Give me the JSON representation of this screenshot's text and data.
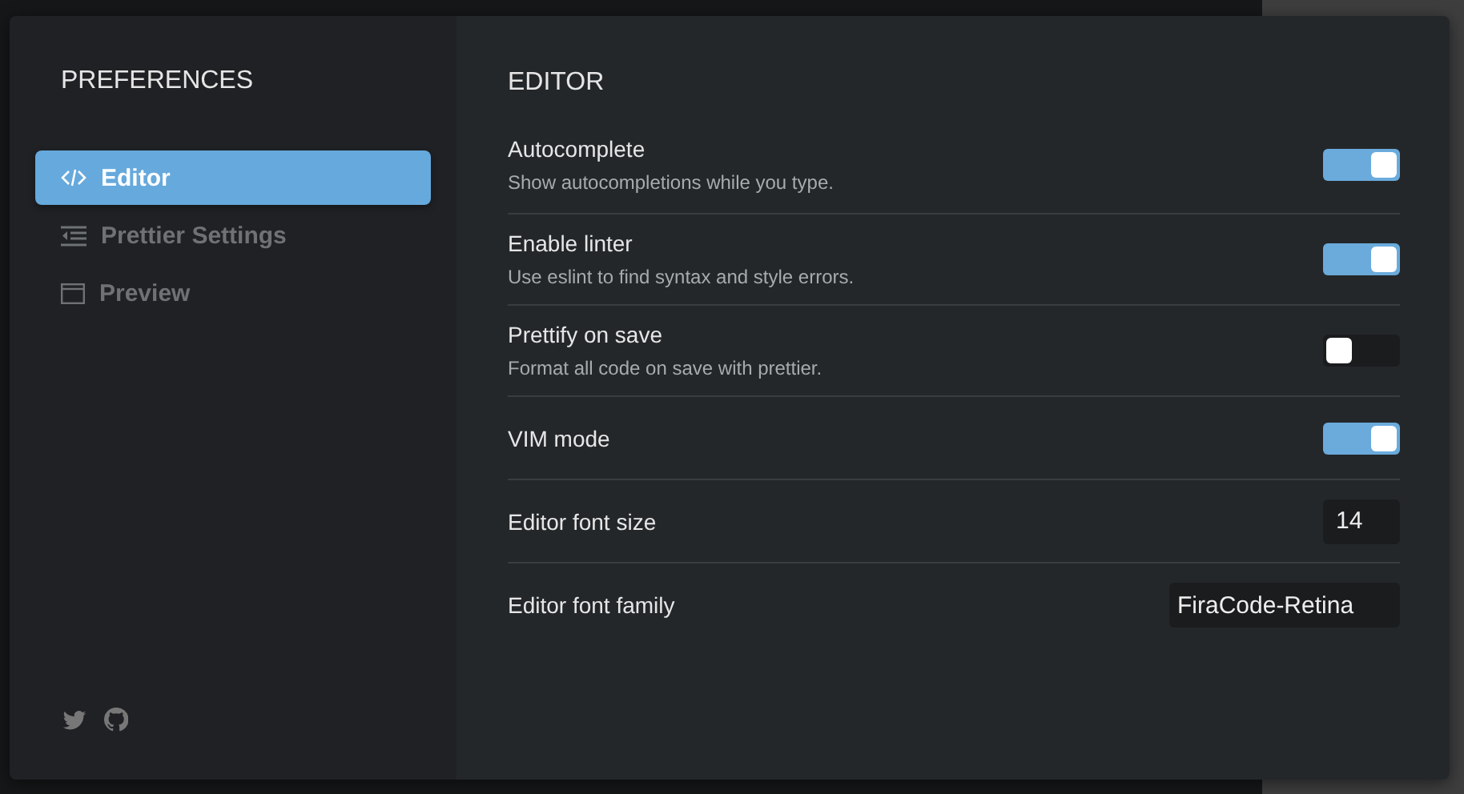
{
  "sidebar": {
    "title": "PREFERENCES",
    "items": [
      {
        "label": "Editor",
        "selected": true
      },
      {
        "label": "Prettier Settings",
        "selected": false
      },
      {
        "label": "Preview",
        "selected": false
      }
    ]
  },
  "main": {
    "title": "EDITOR",
    "settings": [
      {
        "kind": "toggle",
        "label": "Autocomplete",
        "description": "Show autocompletions while you type.",
        "on": true
      },
      {
        "kind": "toggle",
        "label": "Enable linter",
        "description": "Use eslint to find syntax and style errors.",
        "on": true
      },
      {
        "kind": "toggle",
        "label": "Prettify on save",
        "description": "Format all code on save with prettier.",
        "on": false
      },
      {
        "kind": "toggle",
        "label": "VIM mode",
        "on": true
      },
      {
        "kind": "number",
        "label": "Editor font size",
        "value": "14"
      },
      {
        "kind": "text",
        "label": "Editor font family",
        "value": "FiraCode-Retina"
      }
    ]
  }
}
